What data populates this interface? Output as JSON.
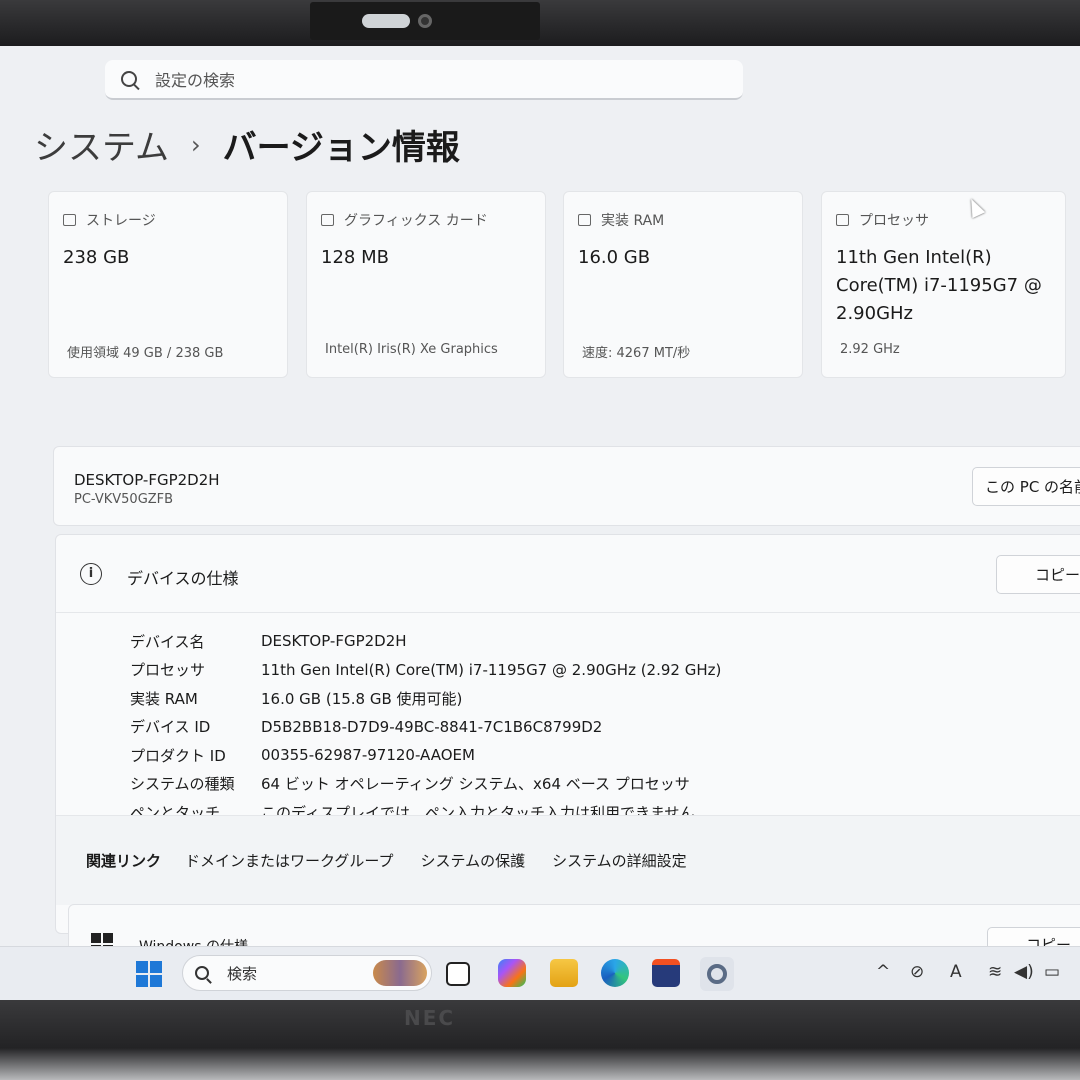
{
  "search": {
    "placeholder": "設定の検索"
  },
  "breadcrumb": {
    "parent": "システム",
    "separator": "›",
    "current": "バージョン情報"
  },
  "cards": [
    {
      "icon": "storage-icon",
      "label": "ストレージ",
      "value": "238 GB",
      "sub": "使用領域 49 GB / 238 GB"
    },
    {
      "icon": "graphics-card-icon",
      "label": "グラフィックス カード",
      "value": "128 MB",
      "sub": "Intel(R) Iris(R) Xe Graphics"
    },
    {
      "icon": "ram-icon",
      "label": "実装 RAM",
      "value": "16.0 GB",
      "sub": "速度: 4267 MT/秒"
    },
    {
      "icon": "processor-icon",
      "label": "プロセッサ",
      "value": "11th Gen Intel(R) Core(TM) i7-1195G7 @ 2.90GHz",
      "sub": "2.92 GHz"
    }
  ],
  "device": {
    "name": "DESKTOP-FGP2D2H",
    "model": "PC-VKV50GZFB",
    "rename_button": "この PC の名前"
  },
  "spec": {
    "title": "デバイスの仕様",
    "copy_button": "コピー",
    "rows": [
      {
        "key": "デバイス名",
        "value": "DESKTOP-FGP2D2H"
      },
      {
        "key": "プロセッサ",
        "value": "11th Gen Intel(R) Core(TM) i7-1195G7 @ 2.90GHz (2.92 GHz)"
      },
      {
        "key": "実装 RAM",
        "value": "16.0 GB (15.8 GB 使用可能)"
      },
      {
        "key": "デバイス ID",
        "value": "D5B2BB18-D7D9-49BC-8841-7C1B6C8799D2"
      },
      {
        "key": "プロダクト ID",
        "value": "00355-62987-97120-AAOEM"
      },
      {
        "key": "システムの種類",
        "value": "64 ビット オペレーティング システム、x64 ベース プロセッサ"
      },
      {
        "key": "ペンとタッチ",
        "value": "このディスプレイでは、ペン入力とタッチ入力は利用できません"
      }
    ],
    "related_label": "関連リンク",
    "related_links": [
      "ドメインまたはワークグループ",
      "システムの保護",
      "システムの詳細設定"
    ]
  },
  "windows_spec": {
    "title": "Windows の仕様",
    "copy_button": "コピー"
  },
  "taskbar": {
    "search_label": "検索",
    "apps": [
      "start-icon",
      "task-view-icon",
      "m365-copilot-icon",
      "file-explorer-icon",
      "edge-icon",
      "store-icon",
      "settings-icon"
    ],
    "tray": {
      "chevron": "^",
      "ime": "A"
    }
  },
  "bezel": {
    "brand": "NEC"
  },
  "colors": {
    "accent": "#1e78d7",
    "window_bg": "#eef0f3",
    "card_bg": "#f9fafb"
  }
}
